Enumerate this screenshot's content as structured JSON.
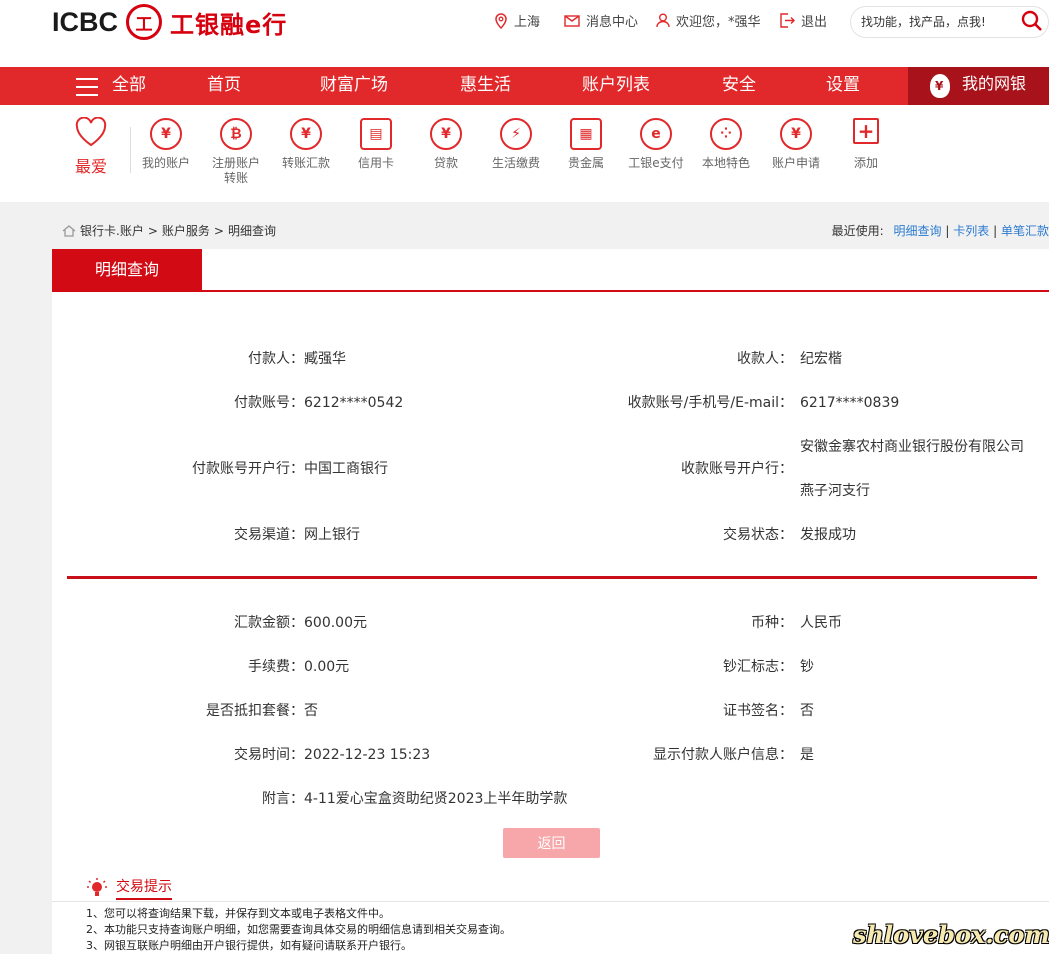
{
  "header": {
    "logo_text": "ICBC",
    "logo_cn": "工银融e行",
    "location": "上海",
    "messages": "消息中心",
    "welcome": "欢迎您，*强华",
    "logout": "退出",
    "search_placeholder": "找功能，找产品，点我!"
  },
  "nav": {
    "all": "全部",
    "items": [
      "首页",
      "财富广场",
      "惠生活",
      "账户列表",
      "安全",
      "设置"
    ],
    "mybank": "我的网银"
  },
  "quick": {
    "fav": "最爱",
    "items": [
      {
        "label": "我的账户",
        "icon": "yen-circle-icon",
        "glyph": "¥"
      },
      {
        "label": "注册账户转账",
        "icon": "transfer-coin-icon",
        "glyph": "₿"
      },
      {
        "label": "转账汇款",
        "icon": "exchange-icon",
        "glyph": "¥"
      },
      {
        "label": "信用卡",
        "icon": "credit-card-icon",
        "glyph": "▤"
      },
      {
        "label": "贷款",
        "icon": "money-bag-icon",
        "glyph": "¥"
      },
      {
        "label": "生活缴费",
        "icon": "drop-bolt-icon",
        "glyph": "⚡"
      },
      {
        "label": "贵金属",
        "icon": "gold-bars-icon",
        "glyph": "▦"
      },
      {
        "label": "工银e支付",
        "icon": "epay-icon",
        "glyph": "e"
      },
      {
        "label": "本地特色",
        "icon": "local-dots-icon",
        "glyph": "⁘"
      },
      {
        "label": "账户申请",
        "icon": "account-apply-icon",
        "glyph": "¥"
      },
      {
        "label": "添加",
        "icon": "add-icon",
        "glyph": "+"
      }
    ]
  },
  "breadcrumb": {
    "items": [
      "银行卡.账户",
      "账户服务",
      "明细查询"
    ],
    "sep": ">"
  },
  "recent": {
    "label": "最近使用:",
    "links": [
      "明细查询",
      "卡列表",
      "单笔汇款"
    ]
  },
  "tab_title": "明细查询",
  "details": {
    "payer_label": "付款人：",
    "payer": "臧强华",
    "payee_label": "收款人：",
    "payee": "纪宏楷",
    "payer_acct_label": "付款账号：",
    "payer_acct": "6212****0542",
    "payee_acct_label": "收款账号/手机号/E-mail：",
    "payee_acct": "6217****0839",
    "payer_bank_label": "付款账号开户行：",
    "payer_bank": "中国工商银行",
    "payee_bank_label": "收款账号开户行：",
    "payee_bank_line1": "安徽金寨农村商业银行股份有限公司",
    "payee_bank_line2": "燕子河支行",
    "channel_label": "交易渠道：",
    "channel": "网上银行",
    "status_label": "交易状态：",
    "status": "发报成功"
  },
  "amounts": {
    "amount_label": "汇款金额：",
    "amount": "600.00元",
    "currency_label": "币种：",
    "currency": "人民币",
    "fee_label": "手续费：",
    "fee": "0.00元",
    "cash_label": "钞汇标志：",
    "cash": "钞",
    "pkg_label": "是否抵扣套餐：",
    "pkg": "否",
    "cert_label": "证书签名：",
    "cert": "否",
    "time_label": "交易时间：",
    "time": "2022-12-23 15:23",
    "show_label": "显示付款人账户信息：",
    "show": "是",
    "memo_label": "附言：",
    "memo": "4-11爱心宝盒资助纪贤2023上半年助学款"
  },
  "back_button": "返回",
  "tips": {
    "title": "交易提示",
    "items": [
      "1、您可以将查询结果下载，并保存到文本或电子表格文件中。",
      "2、本功能只支持查询账户明细，如您需要查询具体交易的明细信息请到相关交易查询。",
      "3、网银互联账户明细由开户银行提供，如有疑问请联系开户银行。"
    ]
  },
  "watermark": "shlovebox.com",
  "colors": {
    "brand_red": "#e1282a",
    "dark_red": "#a8121a",
    "tab_red": "#d10a13",
    "link_blue": "#2c7bd0"
  }
}
